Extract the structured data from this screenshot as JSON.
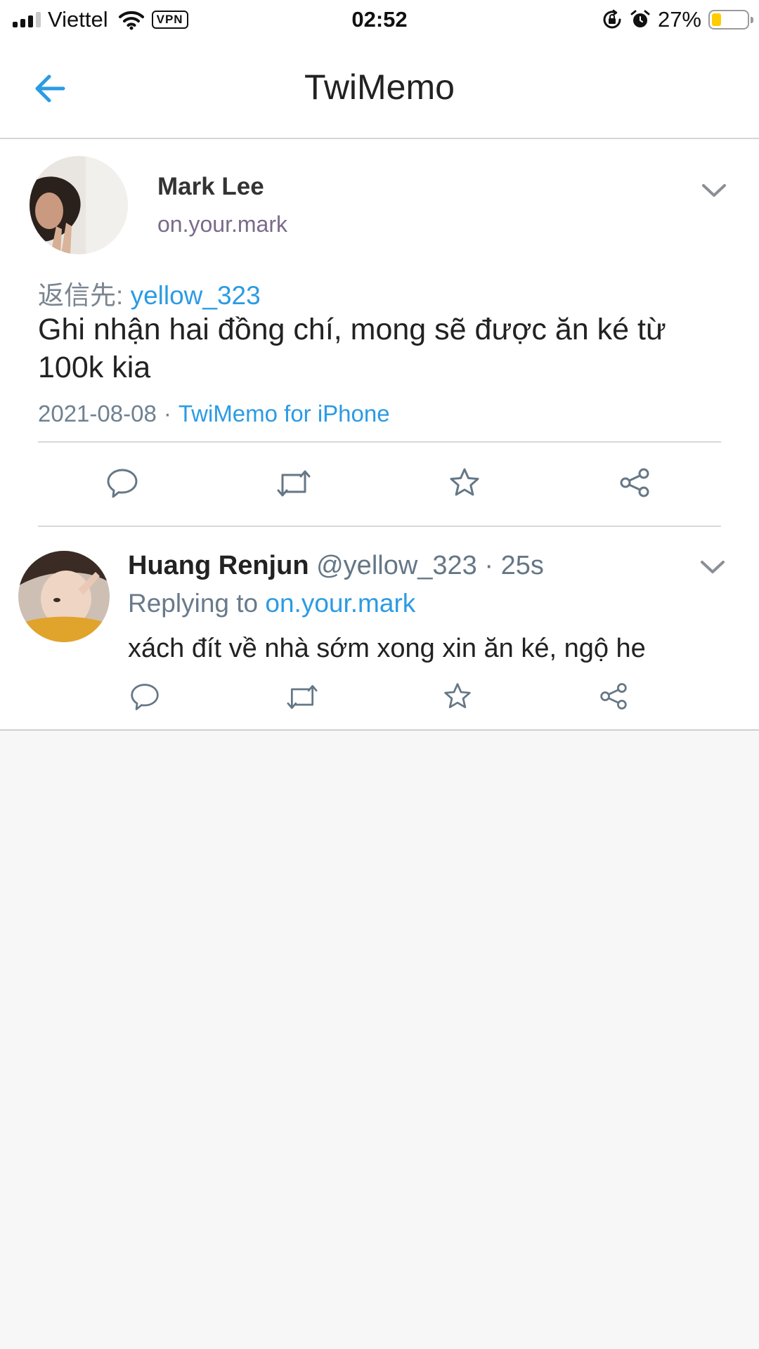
{
  "status_bar": {
    "carrier": "Viettel",
    "vpn": "VPN",
    "time": "02:52",
    "battery_percent": "27%",
    "battery_level": 0.27
  },
  "nav": {
    "title": "TwiMemo",
    "back_icon": "arrow-left-icon"
  },
  "tweet": {
    "name": "Mark Lee",
    "handle": "on.your.mark",
    "reply_to_label": "返信先:",
    "reply_to_user": "yellow_323",
    "text": "Ghi nhận hai đồng chí, mong sẽ được ăn ké từ 100k kia",
    "date": "2021-08-08",
    "separator": "·",
    "source": "TwiMemo for iPhone",
    "actions": [
      "reply-icon",
      "retweet-icon",
      "favorite-icon",
      "share-icon"
    ]
  },
  "reply": {
    "name": "Huang Renjun",
    "handle": "@yellow_323",
    "separator": "·",
    "time": "25s",
    "replying_label": "Replying to",
    "replying_to": "on.your.mark",
    "text": "xách đít về nhà sớm xong xin ăn ké, ngộ he",
    "actions": [
      "reply-icon",
      "retweet-icon",
      "favorite-icon",
      "share-icon"
    ]
  },
  "colors": {
    "accent": "#2b9be3",
    "battery": "#ffcc00",
    "icon_gray": "#657786"
  }
}
